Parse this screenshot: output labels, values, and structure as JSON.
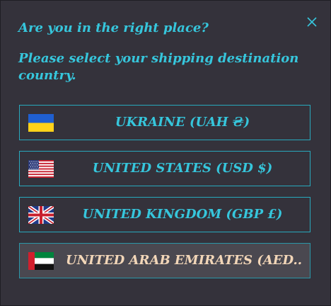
{
  "dialog": {
    "question": "Are you in the right place?",
    "instruction": "Please select your shipping destination country.",
    "close_icon": "close-x-icon",
    "accent_color": "#36c6dc",
    "hover_text_color": "#f2d6b8",
    "background_color": "#34323b"
  },
  "options": [
    {
      "label": "UKRAINE (UAH ₴)",
      "flag_icon": "ukraine-flag-icon"
    },
    {
      "label": "UNITED STATES (USD $)",
      "flag_icon": "usa-flag-icon"
    },
    {
      "label": "UNITED KINGDOM (GBP £)",
      "flag_icon": "uk-flag-icon"
    },
    {
      "label": "UNITED ARAB EMIRATES (AED...",
      "flag_icon": "uae-flag-icon"
    }
  ]
}
